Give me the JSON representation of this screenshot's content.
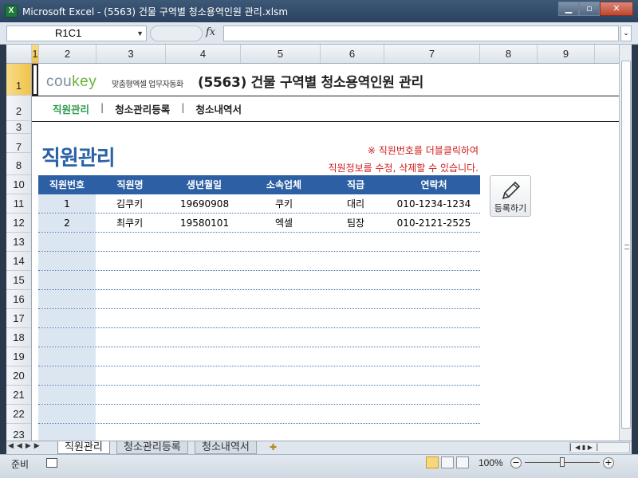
{
  "window": {
    "title": "Microsoft Excel - (5563) 건물 구역별 청소용역인원 관리.xlsm",
    "app_icon": "X",
    "buttons": [
      "minimize",
      "restore",
      "close"
    ]
  },
  "formula_bar": {
    "name_box": "R1C1",
    "fx_label": "fx",
    "formula": ""
  },
  "columns": [
    "1",
    "2",
    "3",
    "4",
    "5",
    "6",
    "7",
    "8",
    "9"
  ],
  "rows": [
    "1",
    "2",
    "3",
    "7",
    "8",
    "10",
    "11",
    "12",
    "13",
    "14",
    "15",
    "16",
    "17",
    "18",
    "19",
    "20",
    "21",
    "22",
    "23"
  ],
  "header": {
    "logo_main": "cou",
    "logo_accent": "key",
    "logo_sub": "맞춤형엑셀 업무자동화",
    "doc_title": "(5563) 건물 구역별 청소용역인원 관리"
  },
  "nav": {
    "tab1": "직원관리",
    "tab2": "청소관리등록",
    "tab3": "청소내역서",
    "sep": "|"
  },
  "section": {
    "title": "직원관리",
    "notice_line1": "※ 직원번호를 더블클릭하여",
    "notice_line2": "직원정보를 수정, 삭제할 수 있습니다."
  },
  "table": {
    "headers": [
      "직원번호",
      "직원명",
      "생년월일",
      "소속업체",
      "직급",
      "연락처"
    ],
    "rows": [
      [
        "1",
        "김쿠키",
        "19690908",
        "쿠키",
        "대리",
        "010-1234-1234"
      ],
      [
        "2",
        "최쿠키",
        "19580101",
        "엑셀",
        "팀장",
        "010-2121-2525"
      ]
    ]
  },
  "register_button": {
    "label": "등록하기",
    "icon": "pencil-icon"
  },
  "sheet_tabs": [
    "직원관리",
    "청소관리등록",
    "청소내역서"
  ],
  "status": {
    "ready": "준비",
    "zoom": "100%",
    "zoom_minus": "−",
    "zoom_plus": "+"
  },
  "colors": {
    "accent_blue": "#2c5fa3",
    "title_blue": "#2a62a8",
    "nav_green": "#2f9b4b",
    "notice_red": "#d01c1c"
  }
}
